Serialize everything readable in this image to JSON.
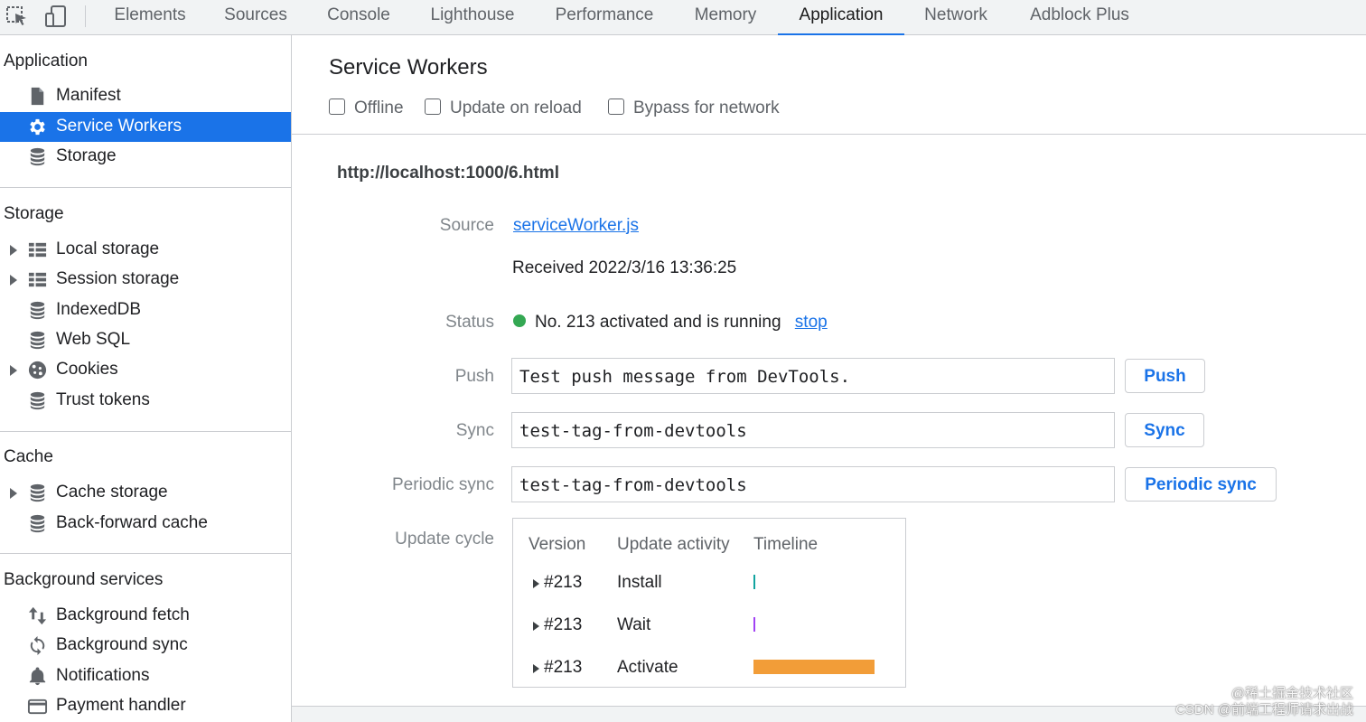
{
  "toolbar": {
    "inspect_icon": "element-picker-icon",
    "device_icon": "device-toggle-icon"
  },
  "tabs": [
    {
      "label": "Elements"
    },
    {
      "label": "Sources"
    },
    {
      "label": "Console"
    },
    {
      "label": "Lighthouse"
    },
    {
      "label": "Performance"
    },
    {
      "label": "Memory"
    },
    {
      "label": "Application",
      "active": true
    },
    {
      "label": "Network"
    },
    {
      "label": "Adblock Plus"
    }
  ],
  "sidebar": {
    "application": {
      "title": "Application",
      "items": [
        {
          "label": "Manifest",
          "icon": "document-icon"
        },
        {
          "label": "Service Workers",
          "icon": "gear-icon",
          "selected": true
        },
        {
          "label": "Storage",
          "icon": "database-icon"
        }
      ]
    },
    "storage": {
      "title": "Storage",
      "items": [
        {
          "label": "Local storage",
          "icon": "table-icon"
        },
        {
          "label": "Session storage",
          "icon": "table-icon"
        },
        {
          "label": "IndexedDB",
          "icon": "database-icon"
        },
        {
          "label": "Web SQL",
          "icon": "database-icon"
        },
        {
          "label": "Cookies",
          "icon": "cookie-icon"
        },
        {
          "label": "Trust tokens",
          "icon": "database-icon"
        }
      ]
    },
    "cache": {
      "title": "Cache",
      "items": [
        {
          "label": "Cache storage",
          "icon": "database-icon"
        },
        {
          "label": "Back-forward cache",
          "icon": "database-icon"
        }
      ]
    },
    "background": {
      "title": "Background services",
      "items": [
        {
          "label": "Background fetch",
          "icon": "up-down-arrows-icon"
        },
        {
          "label": "Background sync",
          "icon": "sync-icon"
        },
        {
          "label": "Notifications",
          "icon": "bell-icon"
        },
        {
          "label": "Payment handler",
          "icon": "credit-card-icon"
        }
      ]
    }
  },
  "main": {
    "title": "Service Workers",
    "options": {
      "offline": "Offline",
      "update_on_reload": "Update on reload",
      "bypass": "Bypass for network"
    },
    "url": "http://localhost:1000/6.html",
    "source": {
      "label": "Source",
      "link": "serviceWorker.js",
      "received": "Received 2022/3/16 13:36:25"
    },
    "status": {
      "label": "Status",
      "text": "No. 213 activated and is running",
      "action": "stop",
      "color": "#34a853"
    },
    "push": {
      "label": "Push",
      "value": "Test push message from DevTools.",
      "button": "Push"
    },
    "sync": {
      "label": "Sync",
      "value": "test-tag-from-devtools",
      "button": "Sync"
    },
    "periodic": {
      "label": "Periodic sync",
      "value": "test-tag-from-devtools",
      "button": "Periodic sync"
    },
    "update_cycle": {
      "label": "Update cycle",
      "headers": {
        "version": "Version",
        "activity": "Update activity",
        "timeline": "Timeline"
      },
      "rows": [
        {
          "version": "#213",
          "activity": "Install",
          "color": "#12a4a0"
        },
        {
          "version": "#213",
          "activity": "Wait",
          "color": "#a142f4"
        },
        {
          "version": "#213",
          "activity": "Activate",
          "color": "#f29d38"
        }
      ]
    }
  },
  "watermark": {
    "line1": "@稀土掘金技术社区",
    "line2": "CSDN @前端工程师请求出战"
  }
}
